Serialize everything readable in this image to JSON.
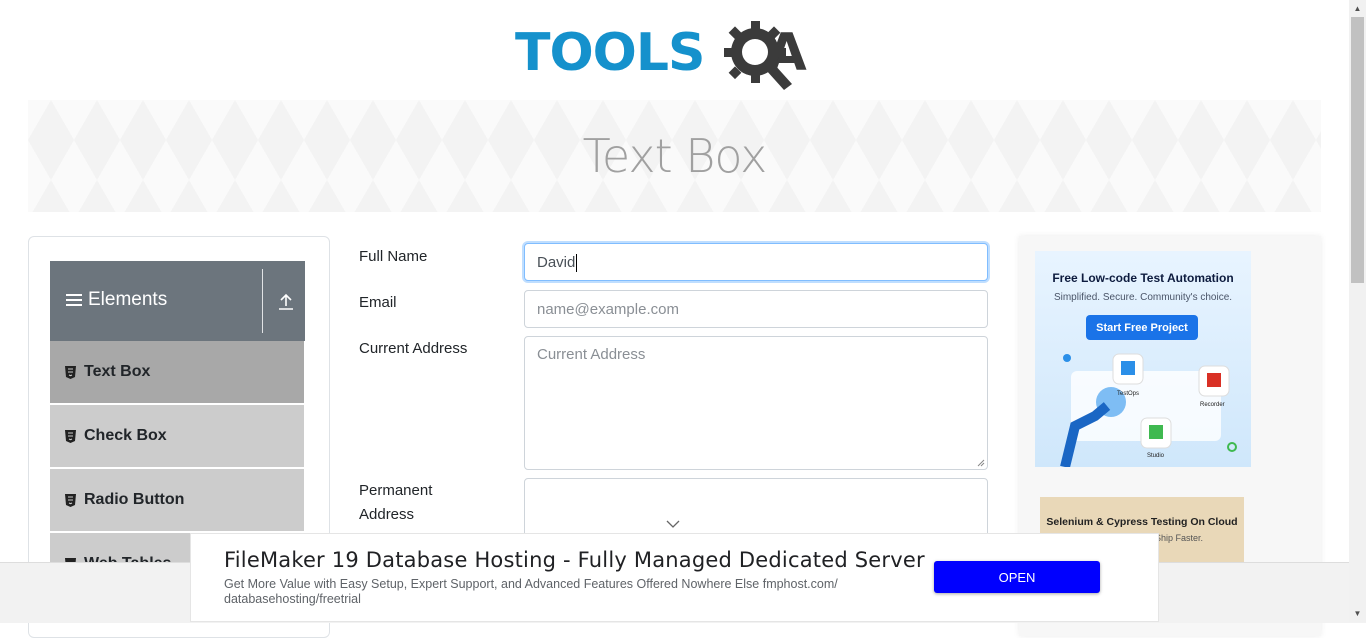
{
  "logo": {
    "part1": "TOOLS",
    "part2": "A",
    "brand_color": "#1591cc",
    "dark_color": "#3b3b3b"
  },
  "banner": {
    "title": "Text Box"
  },
  "sidebar": {
    "group_title": "Elements",
    "items": [
      {
        "label": "Text Box",
        "active": true
      },
      {
        "label": "Check Box",
        "active": false
      },
      {
        "label": "Radio Button",
        "active": false
      },
      {
        "label": "Web Tables",
        "active": false
      }
    ]
  },
  "form": {
    "full_name_label": "Full Name",
    "full_name_value": "David",
    "email_label": "Email",
    "email_placeholder": "name@example.com",
    "current_address_label": "Current Address",
    "current_address_placeholder": "Current Address",
    "permanent_address_label_line1": "Permanent",
    "permanent_address_label_line2": "Address"
  },
  "right_ads": {
    "ad1_title": "Free Low-code Test Automation",
    "ad1_subtitle": "Simplified. Secure. Community's choice.",
    "ad1_button": "Start Free Project",
    "ad1_labels": [
      "TestOps",
      "Recorder",
      "Studio"
    ],
    "ad2_title": "Selenium & Cypress Testing On Cloud",
    "ad2_subtitle": ". Ship Faster."
  },
  "bottom_ad": {
    "headline": "FileMaker 19 Database Hosting - Fully Managed Dedicated Server",
    "description": "Get More Value with Easy Setup, Expert Support, and Advanced Features Offered Nowhere Else fmphost.com/ databasehosting/freetrial",
    "button": "OPEN"
  }
}
